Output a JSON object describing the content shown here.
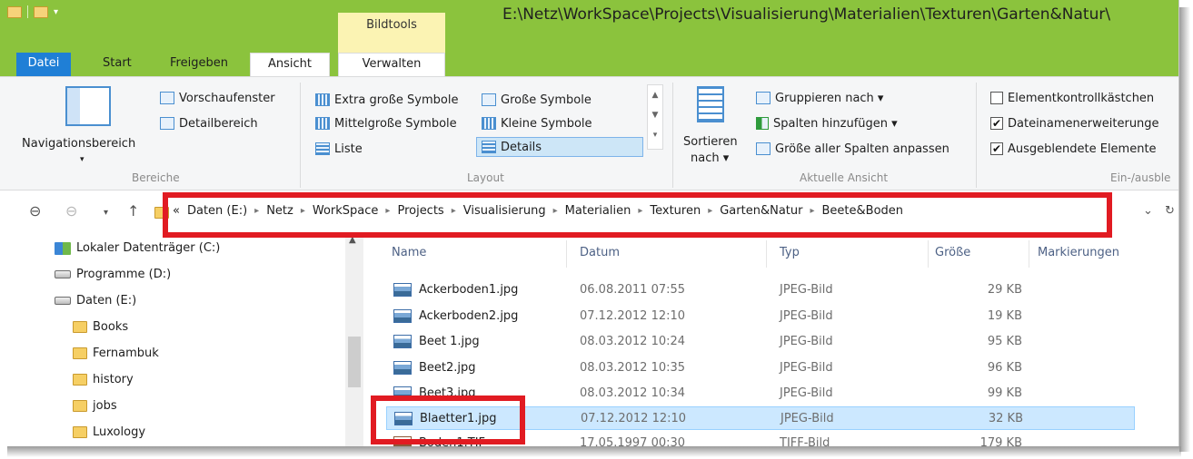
{
  "window": {
    "title_path": "E:\\Netz\\WorkSpace\\Projects\\Visualisierung\\Materialien\\Texturen\\Garten&Natur\\",
    "context_tab": "Bildtools",
    "qat_arrow": "▾"
  },
  "tabs": {
    "file": "Datei",
    "start": "Start",
    "share": "Freigeben",
    "view": "Ansicht",
    "manage": "Verwalten"
  },
  "ribbon": {
    "bereiche": {
      "label": "Bereiche",
      "navigation": "Navigationsbereich",
      "nav_arrow": "▾",
      "preview": "Vorschaufenster",
      "details": "Detailbereich"
    },
    "layout": {
      "label": "Layout",
      "extra_large": "Extra große Symbole",
      "large": "Große Symbole",
      "medium": "Mittelgroße Symbole",
      "small": "Kleine Symbole",
      "list": "Liste",
      "details": "Details"
    },
    "current_view": {
      "label": "Aktuelle Ansicht",
      "sort_line1": "Sortieren",
      "sort_line2": "nach ▾",
      "group_by": "Gruppieren nach ▾",
      "add_columns": "Spalten hinzufügen ▾",
      "size_columns": "Größe aller Spalten anpassen"
    },
    "show_hide": {
      "label": "Ein-/ausble",
      "item_checkboxes": "Elementkontrollkästchen",
      "extensions": "Dateinamenerweiterunge",
      "hidden_items": "Ausgeblendete Elemente",
      "extensions_checked": "✔",
      "hidden_checked": "✔"
    }
  },
  "address": {
    "overflow": "«",
    "crumbs": [
      "Daten (E:)",
      "Netz",
      "WorkSpace",
      "Projects",
      "Visualisierung",
      "Materialien",
      "Texturen",
      "Garten&Natur",
      "Beete&Boden"
    ],
    "separator": "▸",
    "dropdown": "⌄",
    "refresh": "↻"
  },
  "nav_icons": {
    "back": "⊖",
    "forward": "⊖",
    "recent": "▾",
    "up": "↑",
    "scroll_up": "▲"
  },
  "tree": [
    {
      "label": "Lokaler Datenträger (C:)",
      "kind": "drive-c"
    },
    {
      "label": "Programme (D:)",
      "kind": "drive"
    },
    {
      "label": "Daten (E:)",
      "kind": "drive"
    },
    {
      "label": "Books",
      "kind": "folder"
    },
    {
      "label": "Fernambuk",
      "kind": "folder"
    },
    {
      "label": "history",
      "kind": "folder"
    },
    {
      "label": "jobs",
      "kind": "folder"
    },
    {
      "label": "Luxology",
      "kind": "folder"
    }
  ],
  "columns": {
    "name": "Name",
    "date": "Datum",
    "type": "Typ",
    "size": "Größe",
    "tags": "Markierungen"
  },
  "files": [
    {
      "name": "Ackerboden1.jpg",
      "date": "06.08.2011 07:55",
      "type": "JPEG-Bild",
      "size": "29 KB"
    },
    {
      "name": "Ackerboden2.jpg",
      "date": "07.12.2012 12:10",
      "type": "JPEG-Bild",
      "size": "19 KB"
    },
    {
      "name": "Beet 1.jpg",
      "date": "08.03.2012 10:24",
      "type": "JPEG-Bild",
      "size": "95 KB"
    },
    {
      "name": "Beet2.jpg",
      "date": "08.03.2012 10:35",
      "type": "JPEG-Bild",
      "size": "96 KB"
    },
    {
      "name": "Beet3.jpg",
      "date": "08.03.2012 10:34",
      "type": "JPEG-Bild",
      "size": "99 KB"
    },
    {
      "name": "Blaetter1.jpg",
      "date": "07.12.2012 12:10",
      "type": "JPEG-Bild",
      "size": "32 KB",
      "selected": true
    },
    {
      "name": "Boden1.TIF",
      "date": "17.05.1997 00:30",
      "type": "TIFF-Bild",
      "size": "179 KB"
    }
  ],
  "colors": {
    "title_green": "#8bc33d",
    "file_tab_blue": "#1f7fd6",
    "highlight_red": "#e11b22",
    "selection_blue": "#cce8ff"
  }
}
